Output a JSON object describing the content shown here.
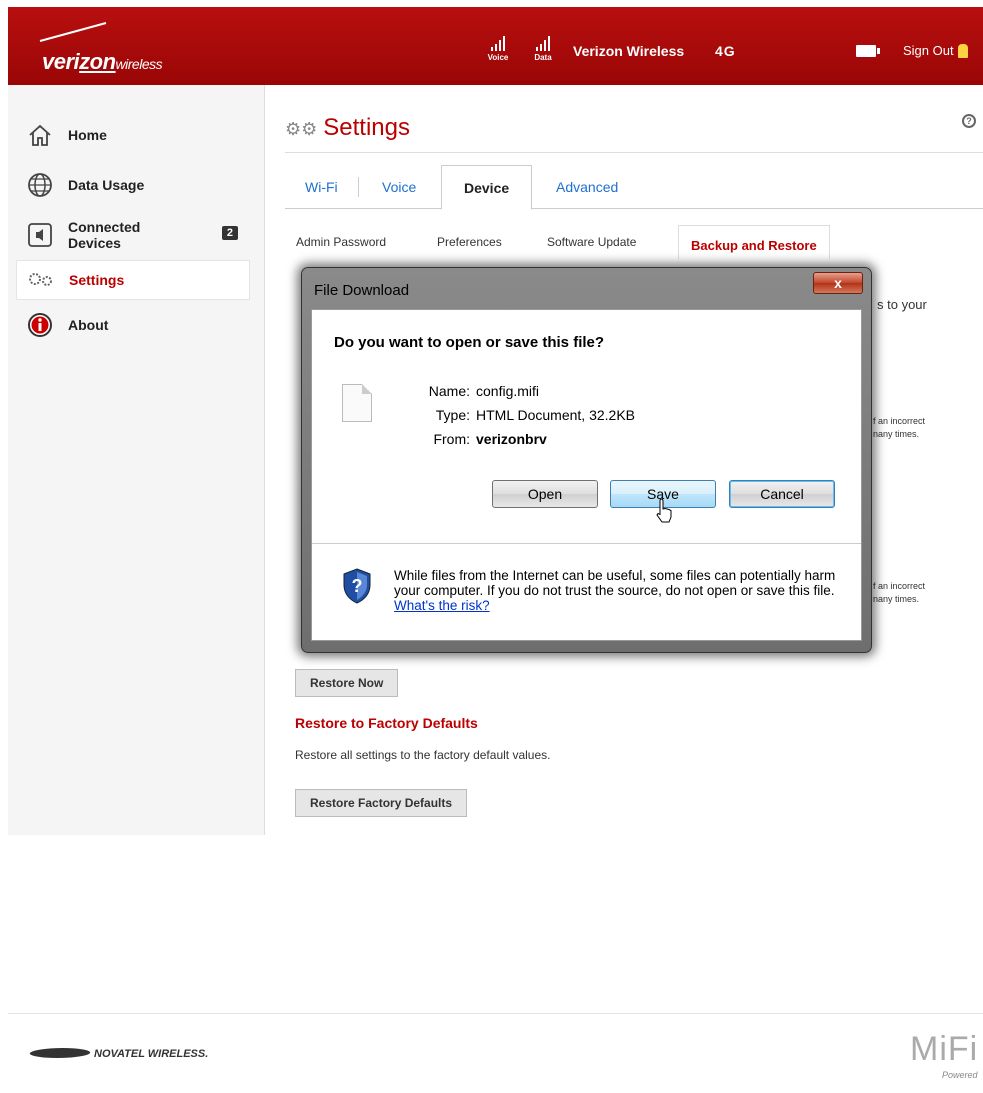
{
  "header": {
    "brand_main": "veri",
    "brand_u": "zon",
    "brand_small": "wireless",
    "voice_label": "Voice",
    "data_label": "Data",
    "carrier": "Verizon Wireless",
    "network": "4G",
    "signout": "Sign Out"
  },
  "sidebar": {
    "items": [
      {
        "label": "Home",
        "icon": "house-icon"
      },
      {
        "label": "Data Usage",
        "icon": "globe-icon"
      },
      {
        "label": "Connected Devices",
        "line1": "Connected",
        "line2": "Devices",
        "badge": "2",
        "icon": "speaker-icon"
      },
      {
        "label": "Settings",
        "icon": "gears-icon"
      },
      {
        "label": "About",
        "icon": "info-icon"
      }
    ]
  },
  "main": {
    "title": "Settings",
    "tabs": [
      "Wi-Fi",
      "Voice",
      "Device",
      "Advanced"
    ],
    "active_tab": "Device",
    "subtabs": [
      "Admin Password",
      "Preferences",
      "Software Update",
      "Backup and Restore"
    ],
    "active_subtab": "Backup and Restore",
    "bg_fragments": {
      "to_your": "s to your",
      "incorrect_1a": "f an incorrect",
      "incorrect_1b": "nany times.",
      "incorrect_2a": "f an incorrect",
      "incorrect_2b": "nany times."
    },
    "restore_now_label": "Restore Now",
    "factory_heading": "Restore to Factory Defaults",
    "factory_text": "Restore all settings to the factory default values.",
    "factory_button": "Restore Factory Defaults"
  },
  "dialog": {
    "title": "File Download",
    "close": "x",
    "question": "Do you want to open or save this file?",
    "name_key": "Name:",
    "name_val": "config.mifi",
    "type_key": "Type:",
    "type_val": "HTML Document, 32.2KB",
    "from_key": "From:",
    "from_val": "verizonbrv",
    "open": "Open",
    "save": "Save",
    "cancel": "Cancel",
    "warning": "While files from the Internet can be useful, some files can potentially harm your computer. If you do not trust the source, do not open or save this file.",
    "risk_link": "What's the risk?"
  },
  "footer": {
    "novatel": "NOVATEL WIRELESS.",
    "mifi": "MiFi",
    "powered": "Powered"
  },
  "colors": {
    "brand_red": "#b00000",
    "link_blue": "#1f6fd1"
  }
}
